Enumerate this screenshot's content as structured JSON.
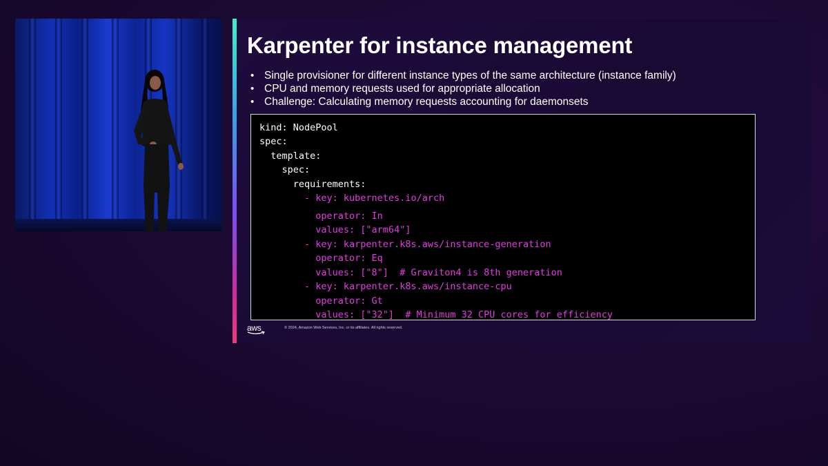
{
  "slide": {
    "title": "Karpenter for instance management",
    "bullets": [
      "Single provisioner for different instance types of the same architecture (instance family)",
      "CPU and memory requests used for appropriate allocation",
      "Challenge: Calculating memory requests accounting for daemonsets"
    ],
    "bullet_glyph": "•",
    "code": [
      "kind: NodePool",
      "spec:",
      "  template:",
      "    spec:",
      "      requirements:",
      "        - key: kubernetes.io/arch",
      "          operator: In",
      "          values: [\"arm64\"]",
      "        - key: karpenter.k8s.aws/instance-generation",
      "          operator: Eq",
      "          values: [\"8\"]  # Graviton4 is 8th generation",
      "        - key: karpenter.k8s.aws/instance-cpu",
      "          operator: Gt",
      "          values: [\"32\"]  # Minimum 32 CPU cores for efficiency"
    ],
    "footer": {
      "logo_text": "aws",
      "copyright": "© 2024, Amazon Web Services, Inc. or its affiliates. All rights reserved."
    }
  },
  "colors": {
    "background": "#1c0a33",
    "code_keyword": "#e03ce0",
    "code_plain": "#ffffff",
    "curtain_blue": "#1230b8"
  },
  "icons": {
    "footer_logo": "aws-logo-icon"
  }
}
